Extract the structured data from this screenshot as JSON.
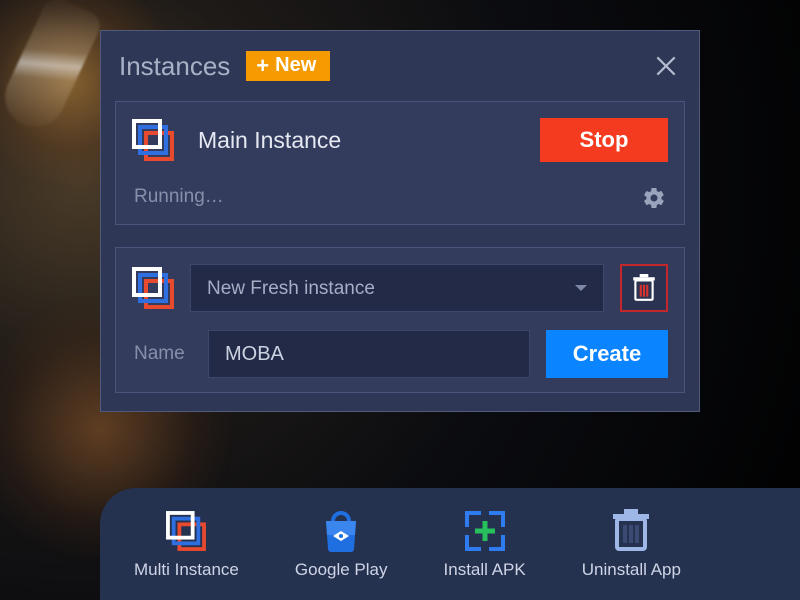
{
  "modal": {
    "title": "Instances",
    "new_button": "New",
    "instance": {
      "name": "Main Instance",
      "stop_label": "Stop",
      "status": "Running…"
    },
    "creator": {
      "template_selected": "New Fresh instance",
      "name_label": "Name",
      "name_value": "MOBA",
      "create_label": "Create"
    }
  },
  "bottom_bar": {
    "items": [
      {
        "label": "Multi Instance"
      },
      {
        "label": "Google Play"
      },
      {
        "label": "Install APK"
      },
      {
        "label": "Uninstall App"
      }
    ]
  }
}
